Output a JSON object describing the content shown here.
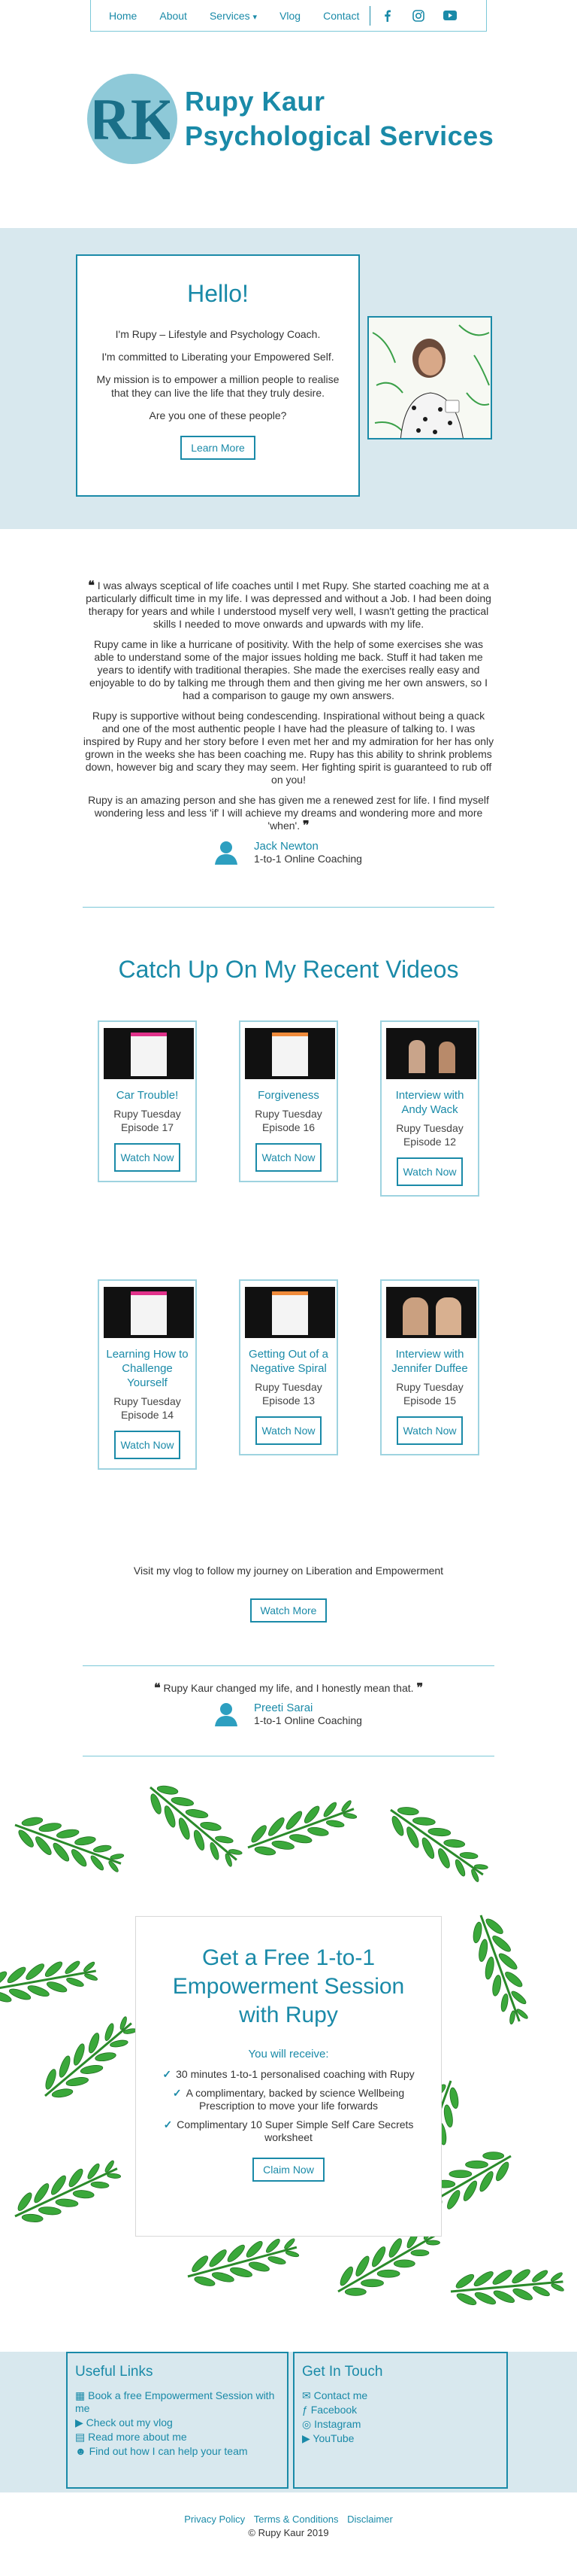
{
  "nav": {
    "items": [
      "Home",
      "About",
      "Services",
      "Vlog",
      "Contact"
    ],
    "services_caret": "▾",
    "social_icons": [
      "facebook-icon",
      "instagram-icon",
      "youtube-icon"
    ]
  },
  "logo": {
    "monogram": "RK",
    "line1": "Rupy Kaur",
    "line2": "Psychological Services"
  },
  "hello": {
    "title": "Hello!",
    "p1": "I'm Rupy – Lifestyle and Psychology Coach.",
    "p2": "I'm committed to Liberating your Empowered Self.",
    "p3": "My mission is to empower a million people to realise that they can live the life that they truly desire.",
    "p4": "Are you one of these people?",
    "button": "Learn More"
  },
  "testimonial1": {
    "p1": "I was always sceptical of life coaches until I met Rupy. She started coaching me at a particularly difficult time in my life. I was depressed and without a Job. I had been doing therapy for years and while I understood myself very well, I wasn't getting the practical skills I needed to move onwards and upwards with my life.",
    "p2": "Rupy came in like a hurricane of positivity. With the help of some exercises she was able to understand some of the major issues holding me back. Stuff it had taken me years to identify with traditional therapies. She made the exercises really easy and enjoyable to do by talking me through them and then giving me her own answers, so I had a comparison to gauge my own answers.",
    "p3": "Rupy is supportive without being condescending. Inspirational without being a quack and one of the most authentic people I have had the pleasure of talking to. I was inspired by Rupy and her story before I even met her and my admiration for her has only grown in the weeks she has been coaching me. Rupy has this ability to shrink problems down, however big and scary they may seem. Her fighting spirit is guaranteed to rub off on you!",
    "p4": "Rupy is an amazing person and she has given me a renewed zest for life. I find myself wondering less and less 'if' I will achieve my dreams and wondering more and more 'when'.",
    "name": "Jack Newton",
    "role": "1-to-1 Online Coaching"
  },
  "videos": {
    "title": "Catch Up On My Recent Videos",
    "cards": [
      {
        "title": "Car Trouble!",
        "sub": "Rupy Tuesday Episode 17",
        "button": "Watch Now"
      },
      {
        "title": "Forgiveness",
        "sub": "Rupy Tuesday Episode 16",
        "button": "Watch Now"
      },
      {
        "title": "Interview with Andy Wack",
        "sub": "Rupy Tuesday Episode 12",
        "button": "Watch Now"
      },
      {
        "title": "Learning How to Challenge Yourself",
        "sub": "Rupy Tuesday Episode 14",
        "button": "Watch Now"
      },
      {
        "title": "Getting Out of a Negative Spiral",
        "sub": "Rupy Tuesday Episode 13",
        "button": "Watch Now"
      },
      {
        "title": "Interview with Jennifer Duffee",
        "sub": "Rupy Tuesday Episode 15",
        "button": "Watch Now"
      }
    ],
    "vlog_text": "Visit my vlog to follow my journey on Liberation and Empowerment",
    "more_button": "Watch More"
  },
  "testimonial2": {
    "quote": "Rupy Kaur changed my life, and I honestly mean that.",
    "name": "Preeti Sarai",
    "role": "1-to-1 Online Coaching"
  },
  "cta": {
    "title": "Get a Free 1-to-1 Empowerment Session with Rupy",
    "receive": "You will receive:",
    "items": [
      "30 minutes 1-to-1 personalised coaching with Rupy",
      "A complimentary, backed by science Wellbeing Prescription to move your life forwards",
      "Complimentary 10 Super Simple Self Care Secrets worksheet"
    ],
    "button": "Claim Now"
  },
  "footer": {
    "useful_title": "Useful Links",
    "useful_links": [
      "Book a free Empowerment Session with me",
      "Check out my vlog",
      "Read more about me",
      "Find out how I can help your team"
    ],
    "touch_title": "Get In Touch",
    "touch_links": [
      "Contact me",
      "Facebook",
      "Instagram",
      "YouTube"
    ],
    "legal": [
      "Privacy Policy",
      "Terms & Conditions",
      "Disclaimer"
    ],
    "copyright": "© Rupy Kaur 2019"
  }
}
